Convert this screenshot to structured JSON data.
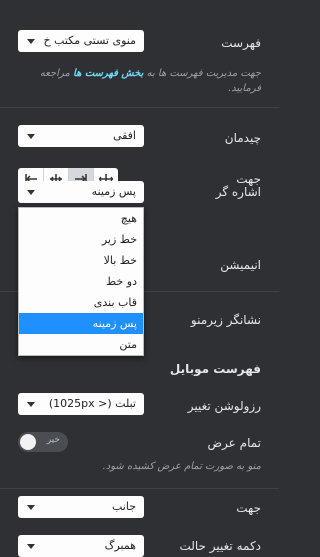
{
  "menu": {
    "label": "فهرست",
    "value": "منوی تستی مکتب خ"
  },
  "description": {
    "before": "جهت مدیریت فهرست ها به ",
    "link": "بخش فهرست ها",
    "after": " مراجعه فرمایید."
  },
  "layout": {
    "label": "چیدمان",
    "value": "افقی"
  },
  "direction": {
    "label": "جهت",
    "options": [
      "align-left-icon",
      "align-center-icon",
      "align-right-icon",
      "align-justify-icon"
    ],
    "active_index": 1
  },
  "pointer": {
    "label": "اشاره گر",
    "value": "پس زمینه",
    "options": [
      "هیچ",
      "خط زیر",
      "خط بالا",
      "دو خط",
      "قاب بندی",
      "پس زمینه",
      "متن"
    ],
    "selected_index": 5
  },
  "animation": {
    "label": "انیمیشن"
  },
  "submenu_indicator": {
    "label": "نشانگر زیرمنو"
  },
  "mobile_section": {
    "title": "فهرست موبایل"
  },
  "breakpoint": {
    "label": "رزولوشن تغییر",
    "value": "تبلت (< 1025px)"
  },
  "full_width": {
    "label": "تمام عرض",
    "toggle_text": "خیر",
    "enabled": false,
    "description": "منو به صورت تمام عرض کشیده شود."
  },
  "mobile_direction": {
    "label": "جهت",
    "value": "جانب"
  },
  "toggle_button": {
    "label": "دکمه تغییر حالت",
    "value": "همبرگ"
  },
  "colors": {
    "background": "#2e3033",
    "accent": "#1e90ff",
    "link": "#71d7f7"
  }
}
